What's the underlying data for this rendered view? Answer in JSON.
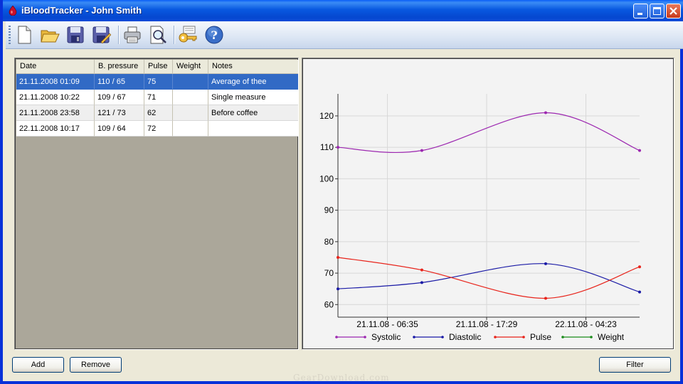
{
  "window": {
    "title": "iBloodTracker - John Smith"
  },
  "toolbar": {
    "buttons": [
      {
        "name": "new-icon"
      },
      {
        "name": "open-folder-icon"
      },
      {
        "name": "save-icon"
      },
      {
        "name": "save-as-icon"
      },
      {
        "name": "print-icon"
      },
      {
        "name": "print-preview-icon"
      },
      {
        "name": "key-icon"
      },
      {
        "name": "help-icon"
      }
    ]
  },
  "grid": {
    "columns": [
      "Date",
      "B. pressure",
      "Pulse",
      "Weight",
      "Notes"
    ],
    "rows": [
      {
        "date": "21.11.2008   01:09",
        "bp": "110 / 65",
        "pulse": "75",
        "weight": "",
        "notes": "Average of thee"
      },
      {
        "date": "21.11.2008   10:22",
        "bp": "109 / 67",
        "pulse": "71",
        "weight": "",
        "notes": "Single measure"
      },
      {
        "date": "21.11.2008   23:58",
        "bp": "121 / 73",
        "pulse": "62",
        "weight": "",
        "notes": "Before coffee"
      },
      {
        "date": "22.11.2008   10:17",
        "bp": "109 / 64",
        "pulse": "72",
        "weight": "",
        "notes": ""
      }
    ],
    "selected_row": 0
  },
  "chart_data": {
    "type": "line",
    "x": [
      "21.11.2008 01:09",
      "21.11.2008 10:22",
      "21.11.2008 23:58",
      "22.11.2008 10:17"
    ],
    "x_tick_labels": [
      "21.11.08 - 06:35",
      "21.11.08 - 17:29",
      "22.11.08 - 04:23"
    ],
    "y_ticks": [
      60,
      70,
      80,
      90,
      100,
      110,
      120
    ],
    "ylim": [
      56,
      127
    ],
    "series": [
      {
        "name": "Systolic",
        "color": "#9c27b0",
        "values": [
          110,
          109,
          121,
          109
        ]
      },
      {
        "name": "Diastolic",
        "color": "#1a1aa6",
        "values": [
          65,
          67,
          73,
          64
        ]
      },
      {
        "name": "Pulse",
        "color": "#e8231a",
        "values": [
          75,
          71,
          62,
          72
        ]
      },
      {
        "name": "Weight",
        "color": "#1a8a1a",
        "values": []
      }
    ],
    "grid": true,
    "legend": "bottom"
  },
  "buttons": {
    "add": "Add",
    "remove": "Remove",
    "filter": "Filter"
  },
  "watermark": "GearDownload.com"
}
